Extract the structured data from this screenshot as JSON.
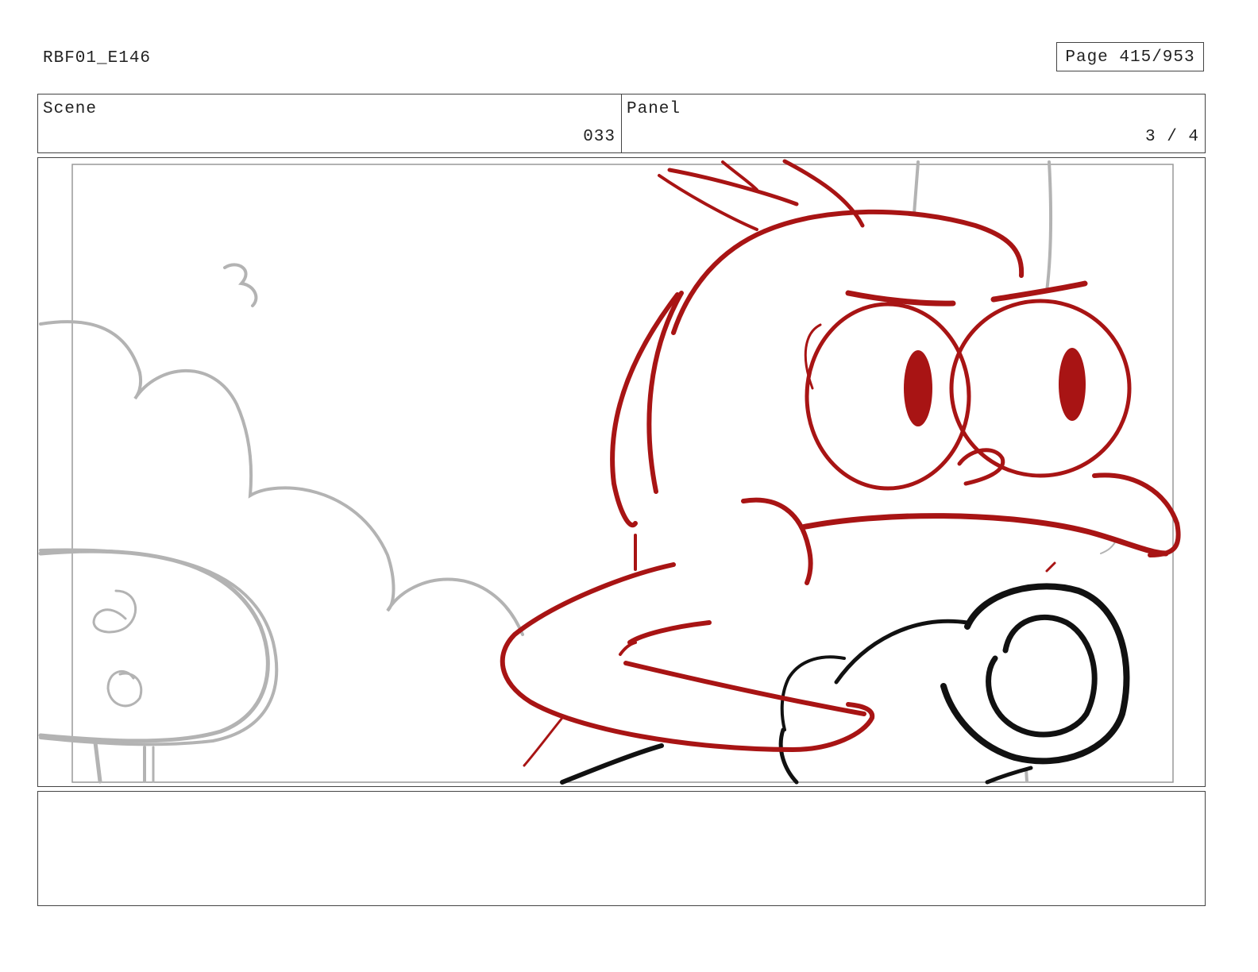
{
  "header": {
    "doc_id": "RBF01_E146",
    "page_label": "Page 415/953"
  },
  "scene": {
    "label": "Scene",
    "value": "033"
  },
  "panel": {
    "label": "Panel",
    "value": "3 / 4"
  },
  "drawing": {
    "description_icon": "storyboard-sketch",
    "colors": {
      "character_red": "#a81414",
      "background_gray": "#b3b3b3",
      "prop_black": "#111111",
      "safe_frame": "#999999"
    }
  },
  "notes": {
    "text": ""
  }
}
